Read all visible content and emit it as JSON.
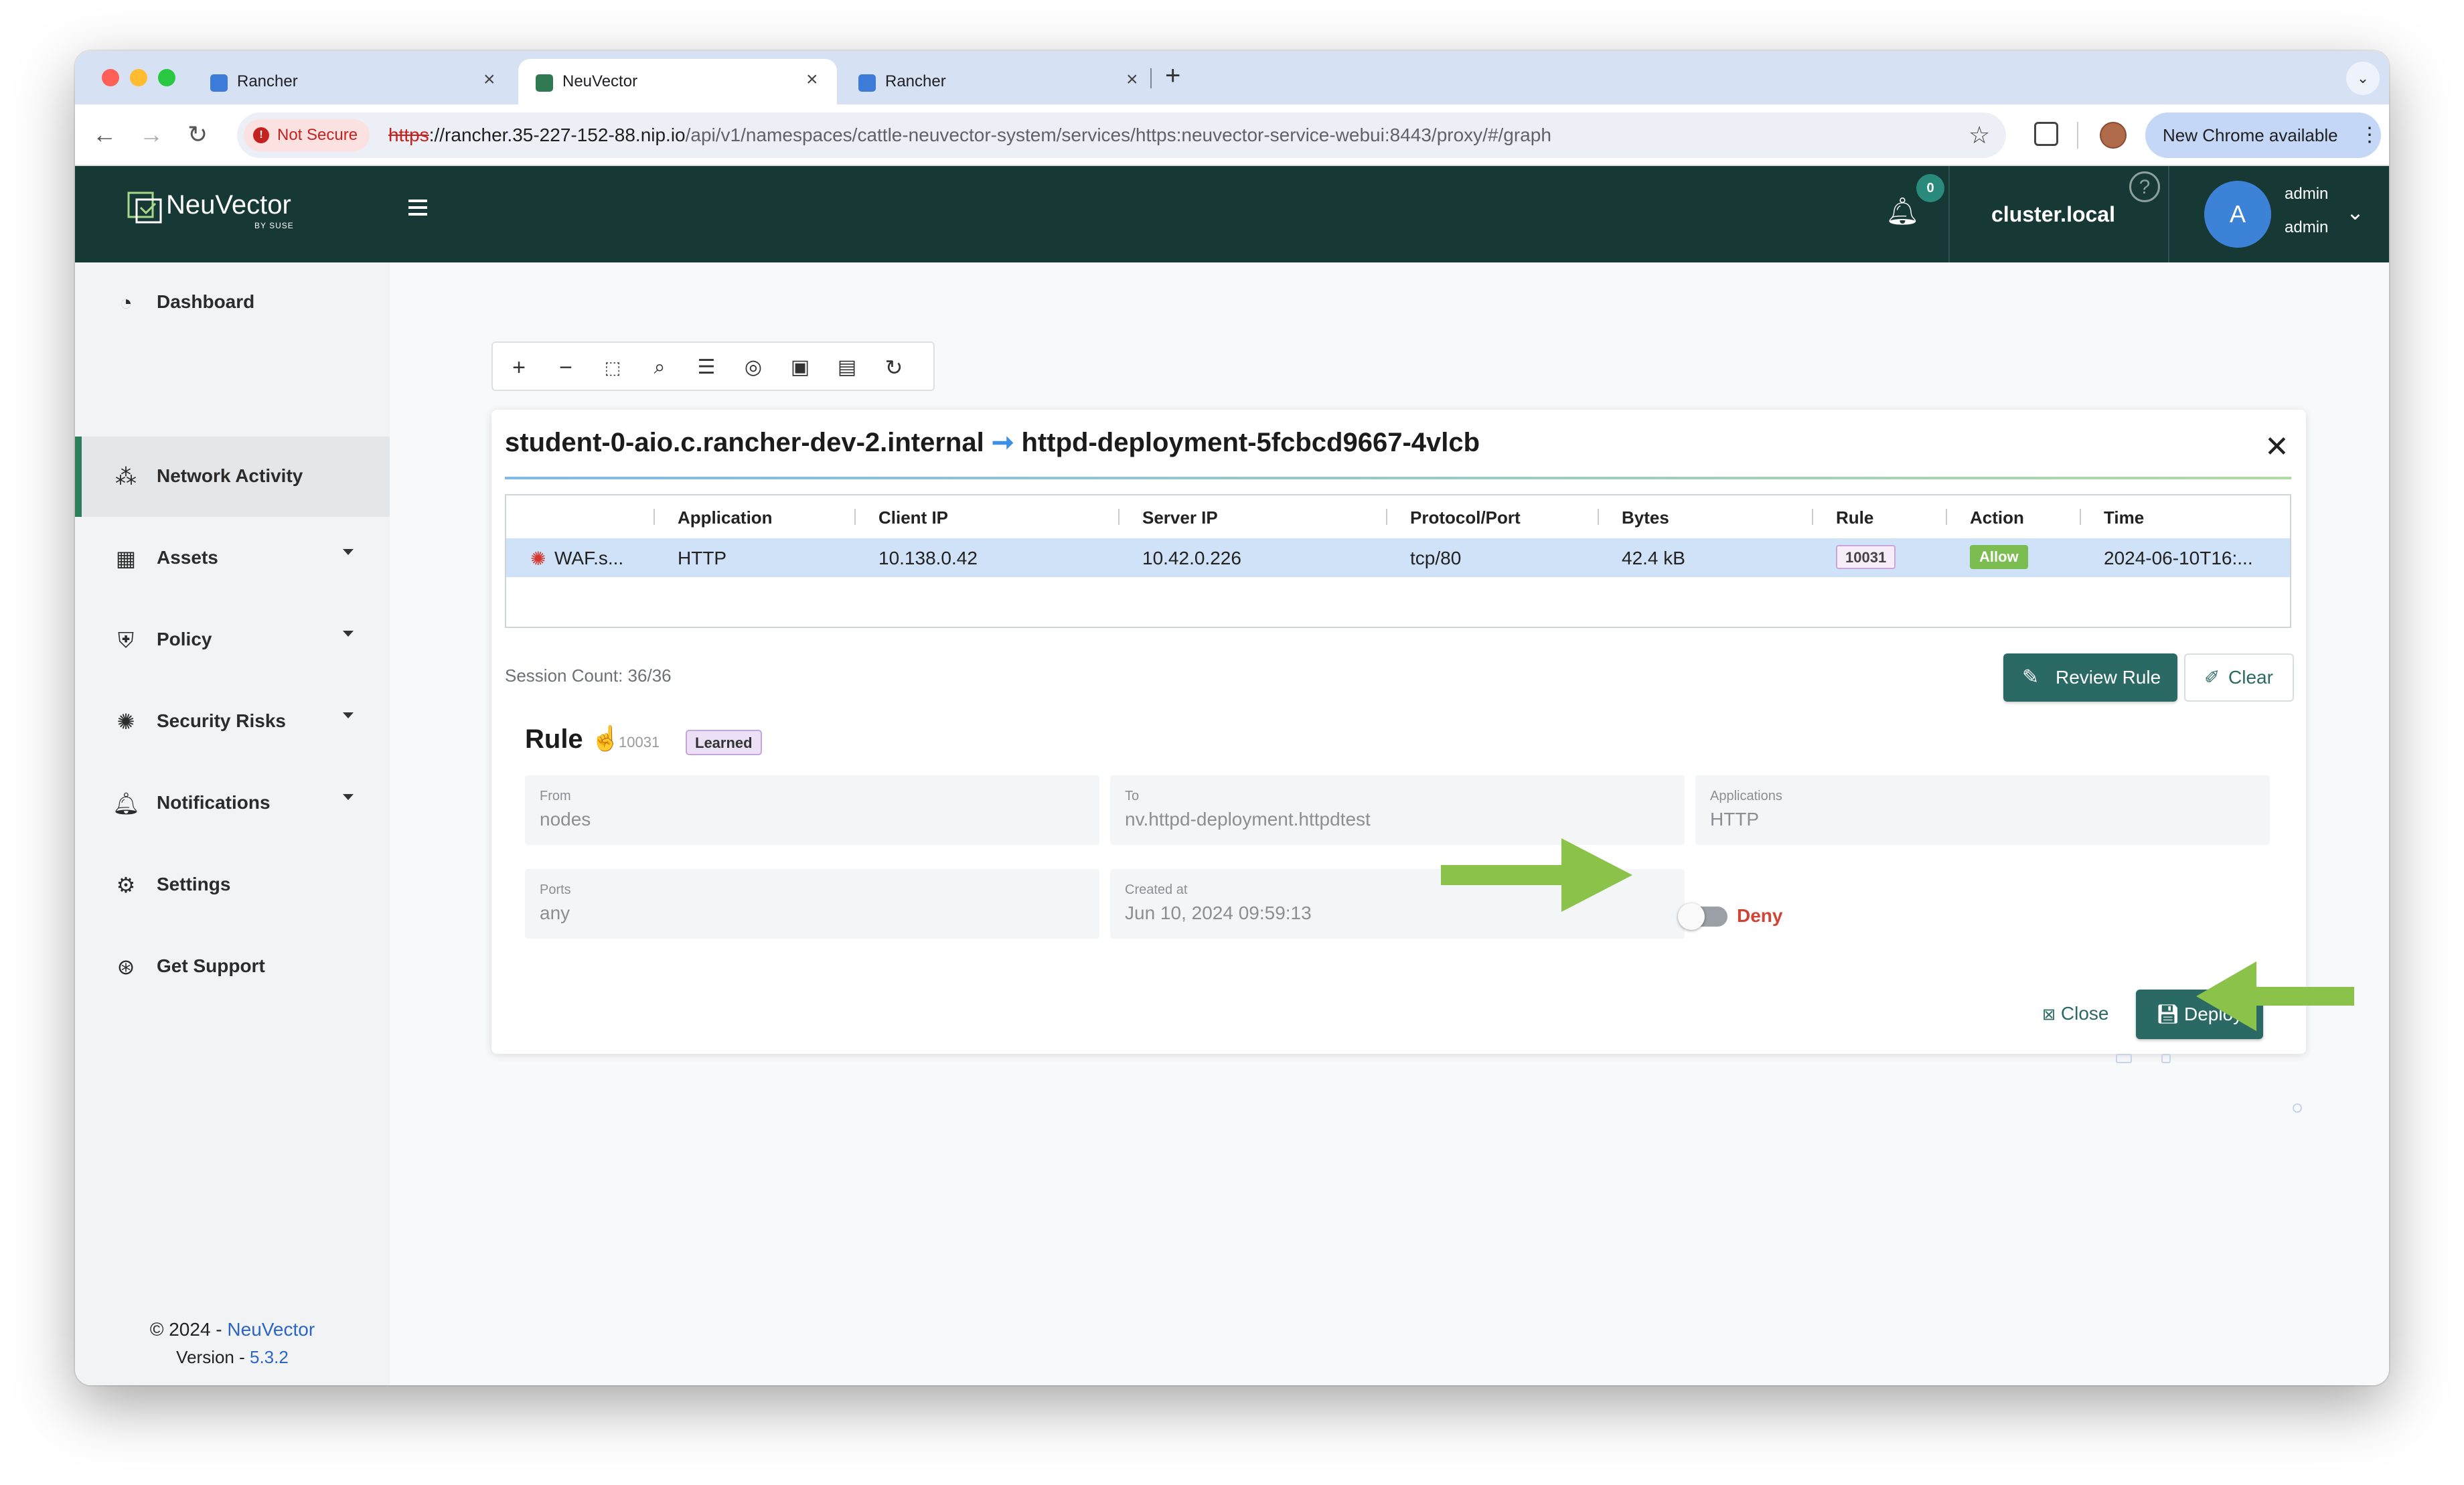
{
  "browser": {
    "tabs": [
      {
        "title": "Rancher",
        "active": false
      },
      {
        "title": "NeuVector",
        "active": true
      },
      {
        "title": "Rancher",
        "active": false
      }
    ],
    "new_tab_glyph": "+",
    "not_secure_label": "Not Secure",
    "url": {
      "scheme": "https",
      "host": "://rancher.35-227-152-88.nip.io",
      "path": "/api/v1/namespaces/cattle-neuvector-system/services/https:neuvector-service-webui:8443/proxy/#/graph"
    },
    "update_button": "New Chrome available"
  },
  "header": {
    "brand": "NeuVector",
    "brand_sub": "BY SUSE",
    "notification_count": "0",
    "cluster": "cluster.local",
    "avatar_initial": "A",
    "user_name": "admin",
    "user_role": "admin"
  },
  "sidebar": {
    "items": [
      {
        "label": "Dashboard",
        "icon": "speedometer-icon"
      },
      {
        "label": "Network Activity",
        "icon": "network-icon",
        "active": true
      },
      {
        "label": "Assets",
        "icon": "assets-icon",
        "expandable": true
      },
      {
        "label": "Policy",
        "icon": "shield-icon",
        "expandable": true
      },
      {
        "label": "Security Risks",
        "icon": "bug-icon",
        "expandable": true
      },
      {
        "label": "Notifications",
        "icon": "bell-icon",
        "expandable": true
      },
      {
        "label": "Settings",
        "icon": "gear-icon"
      },
      {
        "label": "Get Support",
        "icon": "lifebuoy-icon"
      }
    ],
    "footer_copyright": "© 2024 - ",
    "footer_brand": "NeuVector",
    "footer_version_label": "Version - ",
    "footer_version": "5.3.2"
  },
  "panel": {
    "source": "student-0-aio.c.rancher-dev-2.internal",
    "arrow": "➞",
    "destination": "httpd-deployment-5fcbcd9667-4vlcb",
    "table": {
      "headers": [
        "Application",
        "Client IP",
        "Server IP",
        "Protocol/Port",
        "Bytes",
        "Rule",
        "Action",
        "Time"
      ],
      "rows": [
        {
          "name": "WAF.s...",
          "application": "HTTP",
          "client_ip": "10.138.0.42",
          "server_ip": "10.42.0.226",
          "protocol_port": "tcp/80",
          "bytes": "42.4 kB",
          "rule": "10031",
          "action": "Allow",
          "time": "2024-06-10T16:..."
        }
      ]
    },
    "session_count": "Session Count: 36/36",
    "review_rule_button": "Review Rule",
    "clear_button": "Clear"
  },
  "rule": {
    "title": "Rule",
    "id": "10031",
    "badge": "Learned",
    "from_label": "From",
    "from_value": "nodes",
    "to_label": "To",
    "to_value": "nv.httpd-deployment.httpdtest",
    "applications_label": "Applications",
    "applications_value": "HTTP",
    "ports_label": "Ports",
    "ports_value": "any",
    "created_label": "Created at",
    "created_value": "Jun 10, 2024 09:59:13",
    "toggle_label": "Deny",
    "close_label": "Close",
    "deploy_label": "Deploy"
  },
  "colors": {
    "header_bg": "#173936",
    "accent": "#2b6a64",
    "deny": "#d14434",
    "allow": "#7cbd52",
    "arrow": "#8bc34a"
  }
}
